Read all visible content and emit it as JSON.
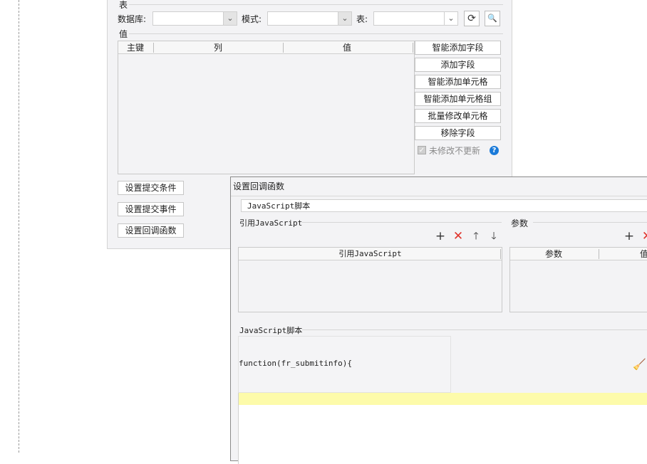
{
  "panel": {
    "table_section_label": "表",
    "database_label": "数据库:",
    "schema_label": "模式:",
    "table_label": "表:",
    "value_section_label": "值",
    "columns": [
      "主键",
      "列",
      "值"
    ],
    "buttons": [
      "智能添加字段",
      "添加字段",
      "智能添加单元格",
      "智能添加单元格组",
      "批量修改单元格",
      "移除字段"
    ],
    "checkbox_label": "未修改不更新",
    "help_icon_text": "?",
    "bottom_buttons": [
      "设置提交条件",
      "设置提交事件",
      "设置回调函数"
    ]
  },
  "dialog": {
    "title": "设置回调函数",
    "type_value": "JavaScript脚本",
    "ref_js_label": "引用JavaScript",
    "ref_js_column": "引用JavaScript",
    "params_label": "参数",
    "params_columns": [
      "参数",
      "值"
    ],
    "script_label": "JavaScript脚本",
    "script_header": "function(fr_submitinfo){"
  },
  "icons": {
    "add": "+",
    "delete": "✕",
    "up": "🡑",
    "down": "🡓",
    "refresh": "⟳",
    "preview": "🔍",
    "dropdown": "⌄",
    "broom": "🧹",
    "check": "✓"
  },
  "colors": {
    "delete_red": "#e0332b",
    "help_blue": "#1a7ad9",
    "highlight_yellow": "#fdfbaa"
  }
}
